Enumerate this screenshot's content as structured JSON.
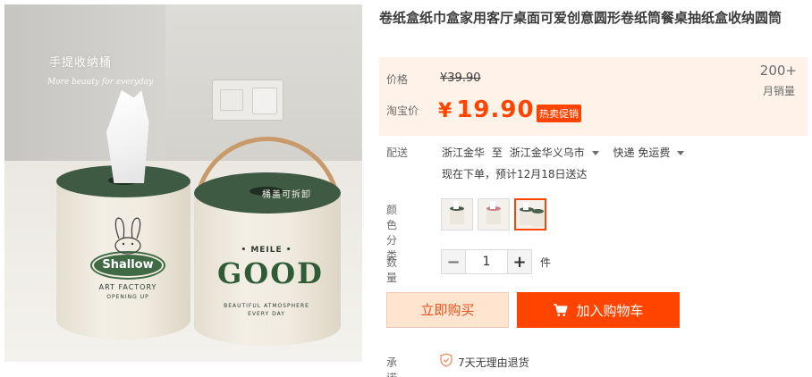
{
  "product_photo": {
    "caption_title": "手提收纳桶",
    "caption_script": "More beauty for everyday",
    "left_can": {
      "logo_text": "Shallow",
      "subtitle": "ART FACTORY",
      "small_text": "OPENING UP"
    },
    "right_can": {
      "top_text": "• MEILE •",
      "logo_text": "GOOD",
      "small_text": "BEAUTIFUL ATMOSPHERE",
      "small_text_2": "EVERY DAY"
    },
    "lid_note": "桶盖可拆卸"
  },
  "product": {
    "title": "卷纸盒纸巾盒家用客厅桌面可爱创意圆形卷纸筒餐桌抽纸盒收纳圆筒"
  },
  "price": {
    "label_price": "价格",
    "original": "¥39.90",
    "label_taobao": "淘宝价",
    "currency": "¥",
    "current": "19.90",
    "hot_badge": "热卖促销",
    "sales_count": "200+",
    "sales_label": "月销量"
  },
  "shipping": {
    "label": "配送",
    "from": "浙江金华",
    "to_word": "至",
    "destination": "浙江金华义乌市",
    "method": "快递 免运费",
    "eta": "现在下单，预计12月18日送达"
  },
  "colors": {
    "label": "颜色分类",
    "swatches": [
      "swatch-1",
      "swatch-2",
      "swatch-3"
    ],
    "selected_index": 2
  },
  "quantity": {
    "label": "数量",
    "value": "1",
    "minus": "−",
    "plus": "+",
    "unit": "件"
  },
  "actions": {
    "buy_now": "立即购买",
    "add_to_cart": "加入购物车"
  },
  "promise": {
    "label": "承诺",
    "text": "7天无理由退货"
  },
  "theme": {
    "accent": "#ff4400",
    "price_bg": "#fff2e8"
  }
}
